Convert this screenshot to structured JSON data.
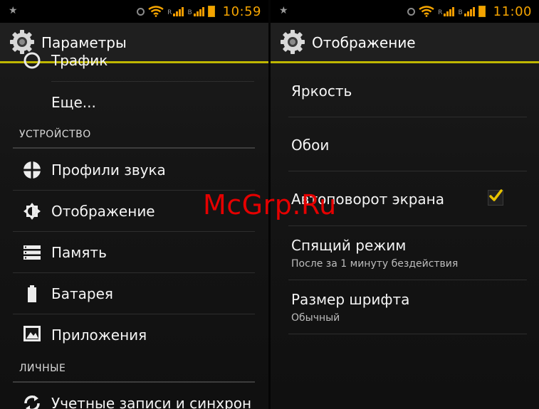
{
  "left_screen": {
    "status": {
      "time": "10:59",
      "signal_label": "R"
    },
    "header": {
      "title": "Параметры"
    },
    "partial_item": "Трафик",
    "more_item": "Еще...",
    "section_device": "УСТРОЙСТВО",
    "device_items": [
      {
        "label": "Профили звука",
        "icon": "sound-profile-icon"
      },
      {
        "label": "Отображение",
        "icon": "display-icon"
      },
      {
        "label": "Память",
        "icon": "storage-icon"
      },
      {
        "label": "Батарея",
        "icon": "battery-icon"
      },
      {
        "label": "Приложения",
        "icon": "apps-icon"
      }
    ],
    "section_personal": "ЛИЧНЫЕ",
    "personal_items": [
      {
        "label": "Учетные записи и синхрон",
        "icon": "sync-icon"
      }
    ]
  },
  "right_screen": {
    "status": {
      "time": "11:00",
      "signal_label": "R"
    },
    "header": {
      "title": "Отображение"
    },
    "items": [
      {
        "label": "Яркость"
      },
      {
        "label": "Обои"
      },
      {
        "label": "Автоповорот экрана",
        "checked": true
      },
      {
        "label": "Спящий режим",
        "summary": "После за 1 минуту бездействия"
      },
      {
        "label": "Размер шрифта",
        "summary": "Обычный"
      }
    ]
  },
  "watermark": "McGrp.Ru",
  "colors": {
    "accent": "#bfb700",
    "status_orange": "#f5a400",
    "watermark": "#e50000"
  }
}
